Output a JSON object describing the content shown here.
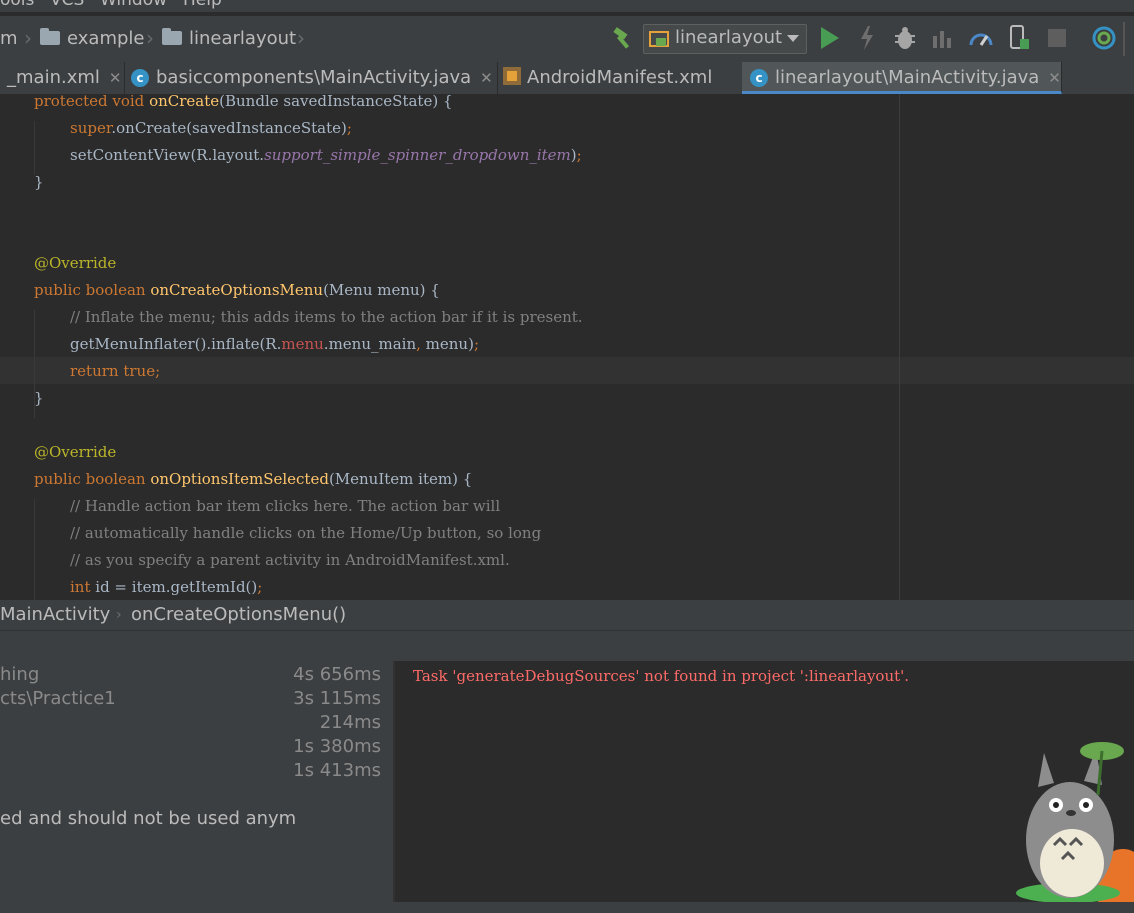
{
  "menu": {
    "items": [
      "ools",
      "VCS",
      "Window",
      "Help"
    ]
  },
  "navbar": {
    "crumbs": [
      "m",
      "example",
      "linearlayout"
    ],
    "run_config": "linearlayout",
    "icons": [
      "hammer-icon",
      "run-icon",
      "lightning-icon",
      "debug-icon",
      "attach-icon",
      "profile-icon",
      "device-icon",
      "stop-icon",
      "coverage-icon"
    ]
  },
  "tabs": [
    {
      "label": "_main.xml",
      "icon": "xml-icon",
      "active": false
    },
    {
      "label": "basiccomponents\\MainActivity.java",
      "icon": "class-icon",
      "active": false
    },
    {
      "label": "AndroidManifest.xml",
      "icon": "manifest-icon",
      "active": false
    },
    {
      "label": "linearlayout\\MainActivity.java",
      "icon": "class-icon",
      "active": true
    }
  ],
  "editor": {
    "lines": [
      [
        [
          "kw",
          "protected void "
        ],
        [
          "fn",
          "onCreate"
        ],
        [
          "",
          "(Bundle savedInstanceState) {"
        ]
      ],
      [
        [
          "kw",
          "super"
        ],
        [
          "",
          ".onCreate(savedInstanceState)"
        ],
        [
          "kw",
          ";"
        ]
      ],
      [
        [
          "",
          "setContentView(R.layout."
        ],
        [
          "fld",
          "support_simple_spinner_dropdown_item"
        ],
        [
          "",
          ")"
        ],
        [
          "kw",
          ";"
        ]
      ],
      [
        [
          "",
          "}"
        ]
      ],
      [],
      [],
      [
        [
          "an",
          "@Override"
        ]
      ],
      [
        [
          "kw",
          "public boolean "
        ],
        [
          "fn",
          "onCreateOptionsMenu"
        ],
        [
          "",
          "(Menu menu) {"
        ]
      ],
      [
        [
          "cm",
          "// Inflate the menu; this adds items to the action bar if it is present."
        ]
      ],
      [
        [
          "",
          "getMenuInflater().inflate(R."
        ],
        [
          "mn",
          "menu"
        ],
        [
          "",
          ".menu_main"
        ],
        [
          "kw",
          ","
        ],
        [
          "",
          " menu)"
        ],
        [
          "kw",
          ";"
        ]
      ],
      [
        [
          "kw",
          "return true;"
        ]
      ],
      [
        [
          "",
          "}"
        ]
      ],
      [],
      [
        [
          "an",
          "@Override"
        ]
      ],
      [
        [
          "kw",
          "public boolean "
        ],
        [
          "fn",
          "onOptionsItemSelected"
        ],
        [
          "",
          "(MenuItem item) {"
        ]
      ],
      [
        [
          "cm",
          "// Handle action bar item clicks here. The action bar will"
        ]
      ],
      [
        [
          "cm",
          "// automatically handle clicks on the Home/Up button, so long"
        ]
      ],
      [
        [
          "cm",
          "// as you specify a parent activity in AndroidManifest.xml."
        ]
      ],
      [
        [
          "kw",
          "int "
        ],
        [
          "",
          "id = item.getItemId()"
        ],
        [
          "kw",
          ";"
        ]
      ]
    ],
    "indents": [
      1,
      2,
      2,
      1,
      0,
      0,
      1,
      1,
      2,
      2,
      2,
      1,
      0,
      1,
      1,
      2,
      2,
      2,
      2
    ]
  },
  "breadcrumb_bottom": {
    "class": "MainActivity",
    "method": "onCreateOptionsMenu()"
  },
  "build": {
    "rows": [
      {
        "label": "hing",
        "time": "4s 656ms"
      },
      {
        "label": "cts\\Practice1",
        "time": "3s 115ms"
      },
      {
        "label": "",
        "time": "214ms"
      },
      {
        "label": "",
        "time": "1s 380ms"
      },
      {
        "label": "",
        "time": "1s 413ms"
      }
    ],
    "warning": "ed and should not be used anym"
  },
  "console": {
    "error": "Task 'generateDebugSources' not found in project ':linearlayout'."
  },
  "colors": {
    "accent": "#4a88c7",
    "error": "#ff6b68",
    "keyword": "#cc7832",
    "function": "#ffc66d",
    "annotation": "#bbb529"
  }
}
